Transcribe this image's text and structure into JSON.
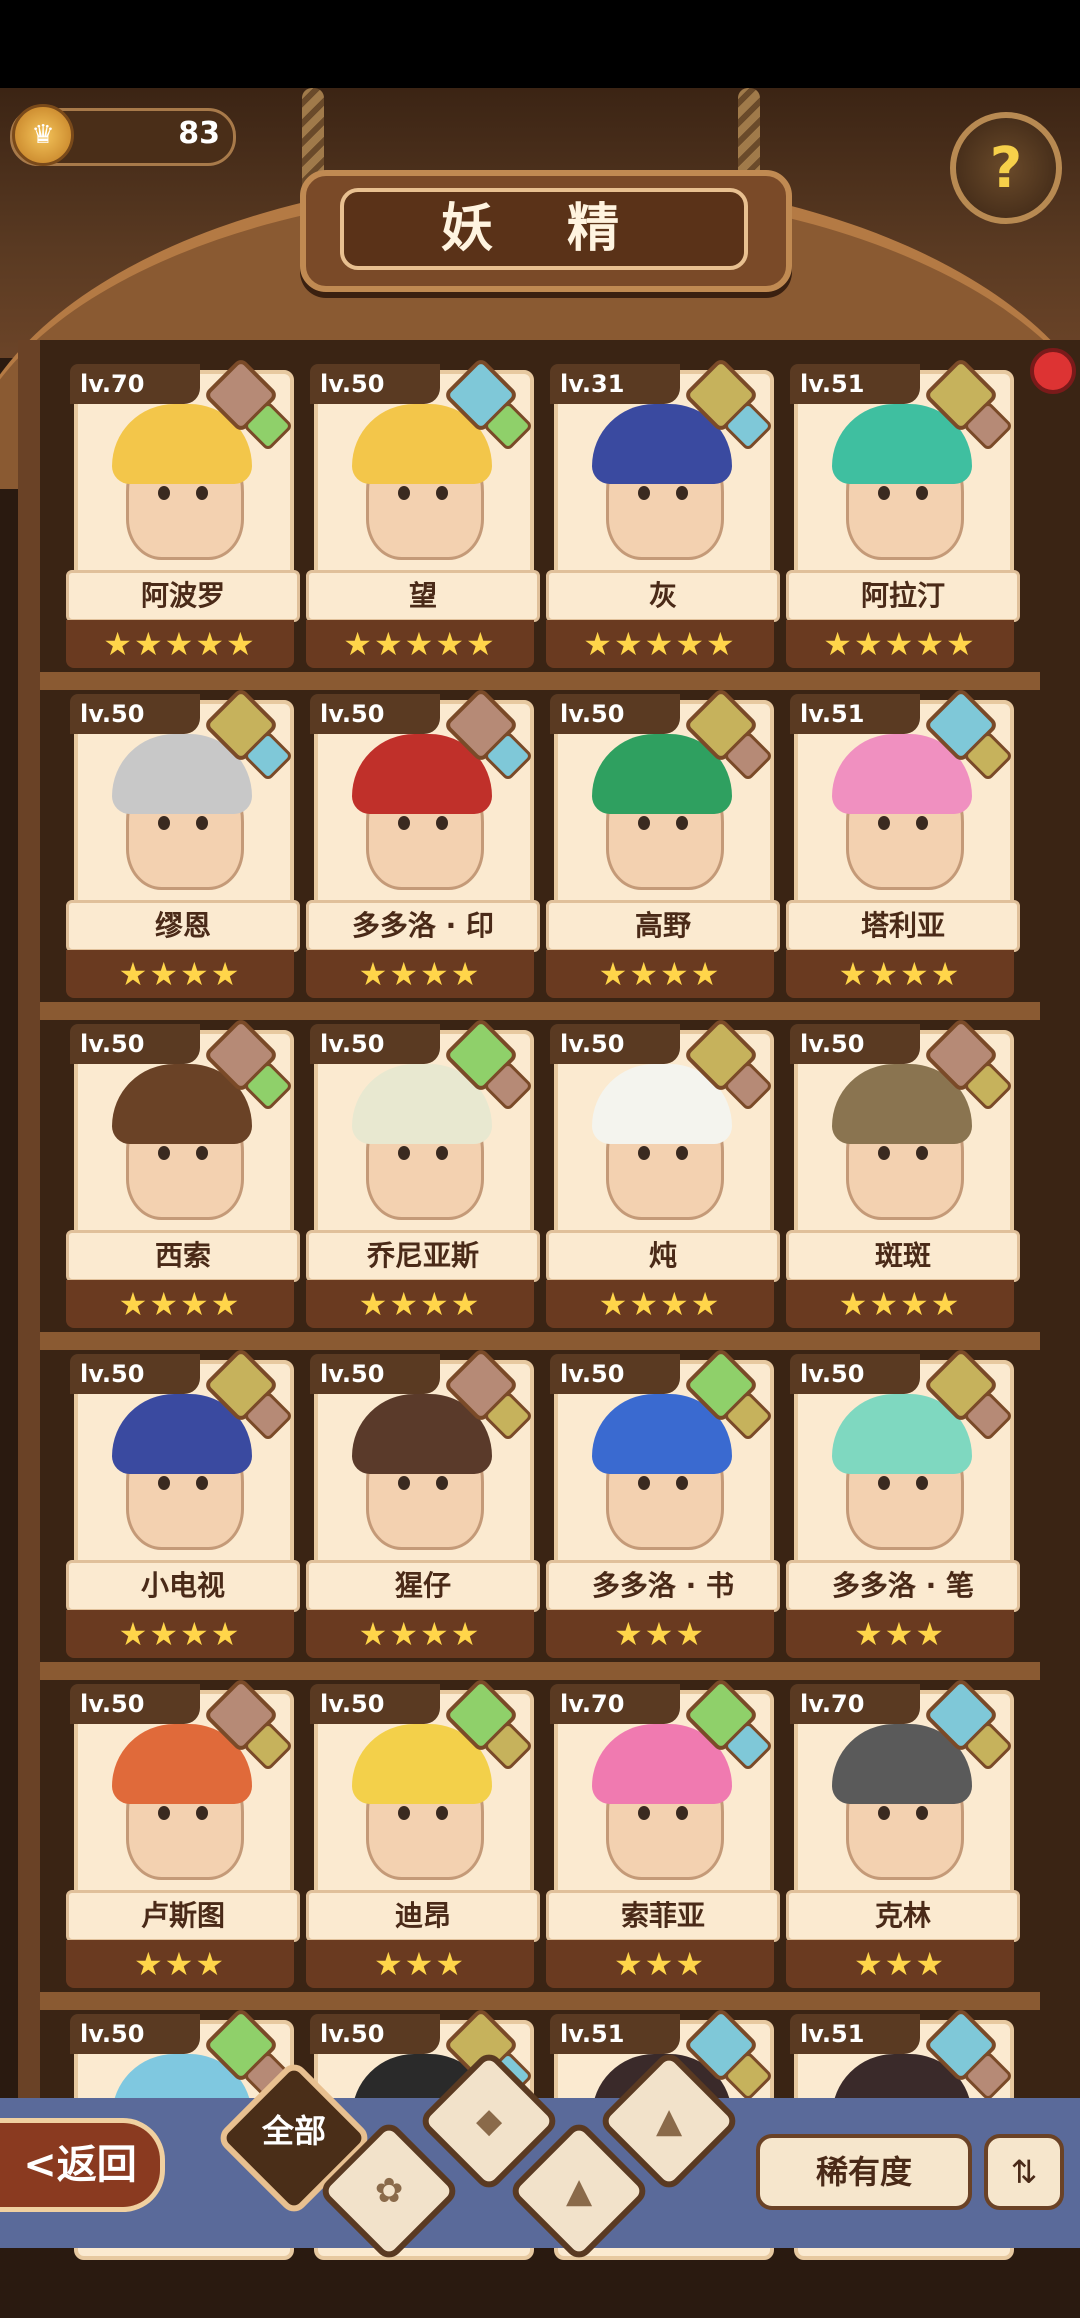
{
  "header": {
    "coin_count": "83",
    "title": "妖 精",
    "help_icon": "question-icon"
  },
  "cards": [
    {
      "level": "lv.70",
      "name": "阿波罗",
      "stars": 5,
      "gems": [
        "#b68a76",
        "#8fd06a"
      ],
      "hair": "#f3c64a"
    },
    {
      "level": "lv.50",
      "name": "望",
      "stars": 5,
      "gems": [
        "#7fc8d8",
        "#8fd06a"
      ],
      "hair": "#f3c64a"
    },
    {
      "level": "lv.31",
      "name": "灰",
      "stars": 5,
      "gems": [
        "#c6b25c",
        "#7fc8d8"
      ],
      "hair": "#3a4aa0"
    },
    {
      "level": "lv.51",
      "name": "阿拉汀",
      "stars": 5,
      "gems": [
        "#c6b25c",
        "#b68a76"
      ],
      "hair": "#3fbfa0"
    },
    {
      "level": "lv.50",
      "name": "缪恩",
      "stars": 4,
      "gems": [
        "#c6b25c",
        "#7fc8d8"
      ],
      "hair": "#c8c8c8"
    },
    {
      "level": "lv.50",
      "name": "多多洛 · 印",
      "stars": 4,
      "gems": [
        "#b68a76",
        "#7fc8d8"
      ],
      "hair": "#c0302a"
    },
    {
      "level": "lv.50",
      "name": "高野",
      "stars": 4,
      "gems": [
        "#c6b25c",
        "#b68a76"
      ],
      "hair": "#2fa060"
    },
    {
      "level": "lv.51",
      "name": "塔利亚",
      "stars": 4,
      "gems": [
        "#7fc8d8",
        "#c6b25c"
      ],
      "hair": "#f090c0"
    },
    {
      "level": "lv.50",
      "name": "西索",
      "stars": 4,
      "gems": [
        "#b68a76",
        "#8fd06a"
      ],
      "hair": "#6a4226"
    },
    {
      "level": "lv.50",
      "name": "乔尼亚斯",
      "stars": 4,
      "gems": [
        "#8fd06a",
        "#b68a76"
      ],
      "hair": "#e8e8d0"
    },
    {
      "level": "lv.50",
      "name": "炖",
      "stars": 4,
      "gems": [
        "#c6b25c",
        "#b68a76"
      ],
      "hair": "#f4f4ee"
    },
    {
      "level": "lv.50",
      "name": "斑斑",
      "stars": 4,
      "gems": [
        "#b68a76",
        "#c6b25c"
      ],
      "hair": "#8a7450"
    },
    {
      "level": "lv.50",
      "name": "小电视",
      "stars": 4,
      "gems": [
        "#c6b25c",
        "#b68a76"
      ],
      "hair": "#3a4aa0"
    },
    {
      "level": "lv.50",
      "name": "猩仔",
      "stars": 4,
      "gems": [
        "#b68a76",
        "#c6b25c"
      ],
      "hair": "#5a3a2a"
    },
    {
      "level": "lv.50",
      "name": "多多洛 · 书",
      "stars": 3,
      "gems": [
        "#8fd06a",
        "#c6b25c"
      ],
      "hair": "#3a6ad0"
    },
    {
      "level": "lv.50",
      "name": "多多洛 · 笔",
      "stars": 3,
      "gems": [
        "#c6b25c",
        "#b68a76"
      ],
      "hair": "#7fd8c0"
    },
    {
      "level": "lv.50",
      "name": "卢斯图",
      "stars": 3,
      "gems": [
        "#b68a76",
        "#c6b25c"
      ],
      "hair": "#e06a3a"
    },
    {
      "level": "lv.50",
      "name": "迪昂",
      "stars": 3,
      "gems": [
        "#8fd06a",
        "#c6b25c"
      ],
      "hair": "#f3d04a"
    },
    {
      "level": "lv.70",
      "name": "索菲亚",
      "stars": 3,
      "gems": [
        "#8fd06a",
        "#7fc8d8"
      ],
      "hair": "#f07ab0"
    },
    {
      "level": "lv.70",
      "name": "克林",
      "stars": 3,
      "gems": [
        "#7fc8d8",
        "#c6b25c"
      ],
      "hair": "#5a5a5a"
    },
    {
      "level": "lv.50",
      "name": "",
      "stars": 0,
      "gems": [
        "#8fd06a",
        "#b68a76"
      ],
      "hair": "#7fc8e0"
    },
    {
      "level": "lv.50",
      "name": "",
      "stars": 0,
      "gems": [
        "#c6b25c",
        "#7fc8d8"
      ],
      "hair": "#2a2a2a"
    },
    {
      "level": "lv.51",
      "name": "",
      "stars": 0,
      "gems": [
        "#7fc8d8",
        "#c6b25c"
      ],
      "hair": "#3a2a2a"
    },
    {
      "level": "lv.51",
      "name": "",
      "stars": 0,
      "gems": [
        "#7fc8d8",
        "#b68a76"
      ],
      "hair": "#3a2a2a"
    }
  ],
  "bottom": {
    "back_label": "<返回",
    "filter_all": "全部",
    "rarity_label": "稀有度",
    "sort_icon": "sort-icon"
  }
}
